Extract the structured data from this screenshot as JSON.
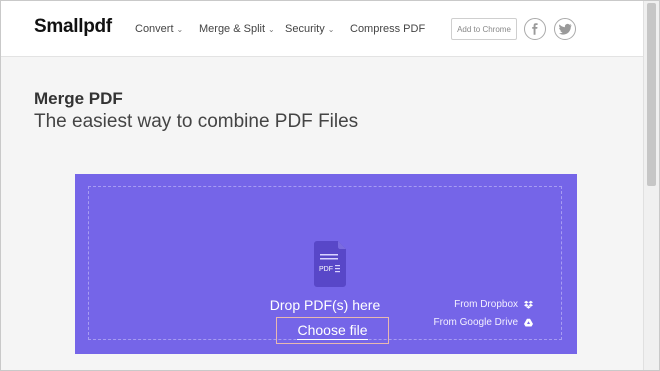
{
  "header": {
    "logo": "Smallpdf",
    "nav": [
      {
        "label": "Convert",
        "has_dropdown": true
      },
      {
        "label": "Merge & Split",
        "has_dropdown": true
      },
      {
        "label": "Security",
        "has_dropdown": true
      },
      {
        "label": "Compress PDF",
        "has_dropdown": false
      }
    ],
    "chrome_button": "Add to Chrome",
    "social": [
      "facebook-icon",
      "twitter-icon"
    ]
  },
  "page": {
    "title": "Merge PDF",
    "subtitle": "The easiest way to combine PDF Files"
  },
  "dropzone": {
    "icon_label": "PDF",
    "drop_text": "Drop PDF(s) here",
    "choose_label": "Choose file",
    "sources": [
      {
        "label": "From Dropbox",
        "icon": "dropbox-icon"
      },
      {
        "label": "From Google Drive",
        "icon": "google-drive-icon"
      }
    ]
  },
  "colors": {
    "dropzone_bg": "#7565e8",
    "dropzone_dash": "#a79cf2",
    "header_bg": "#ffffff",
    "page_bg": "#f5f5f5"
  }
}
